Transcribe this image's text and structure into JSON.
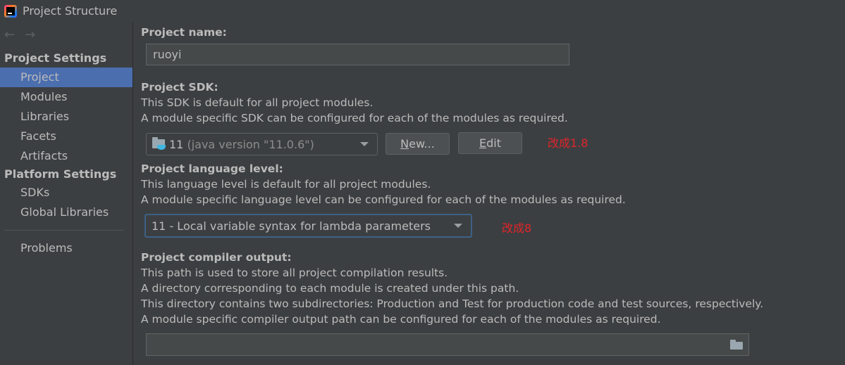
{
  "window": {
    "title": "Project Structure",
    "app_icon": "intellij-idea-icon"
  },
  "sidebar": {
    "nav_back_icon": "←",
    "nav_forward_icon": "→",
    "sections": [
      {
        "header": "Project Settings",
        "items": [
          {
            "label": "Project",
            "selected": true
          },
          {
            "label": "Modules"
          },
          {
            "label": "Libraries"
          },
          {
            "label": "Facets"
          },
          {
            "label": "Artifacts"
          }
        ]
      },
      {
        "header": "Platform Settings",
        "items": [
          {
            "label": "SDKs"
          },
          {
            "label": "Global Libraries"
          }
        ]
      }
    ],
    "problems_label": "Problems"
  },
  "main": {
    "project_name": {
      "label": "Project name:",
      "value": "ruoyi"
    },
    "project_sdk": {
      "label": "Project SDK:",
      "desc_1": "This SDK is default for all project modules.",
      "desc_2": "A module specific SDK can be configured for each of the modules as required.",
      "selected_version": "11",
      "selected_detail": "(java version \"11.0.6\")",
      "new_button_mnemonic": "N",
      "new_button_rest": "ew...",
      "edit_button_mnemonic": "E",
      "edit_button_rest": "dit",
      "annotation": "改成1.8"
    },
    "language_level": {
      "label": "Project language level:",
      "desc_1": "This language level is default for all project modules.",
      "desc_2": "A module specific language level can be configured for each of the modules as required.",
      "selected": "11 - Local variable syntax for lambda parameters",
      "annotation": "改成8"
    },
    "compiler_output": {
      "label": "Project compiler output:",
      "desc_1": "This path is used to store all project compilation results.",
      "desc_2": "A directory corresponding to each module is created under this path.",
      "desc_3": "This directory contains two subdirectories: Production and Test for production code and test sources, respectively.",
      "desc_4": "A module specific compiler output path can be configured for each of the modules as required.",
      "value": ""
    }
  },
  "colors": {
    "background": "#3c3f41",
    "selection": "#4b6eaf",
    "annotation": "#e0242a",
    "focus_border": "#3d6185"
  }
}
